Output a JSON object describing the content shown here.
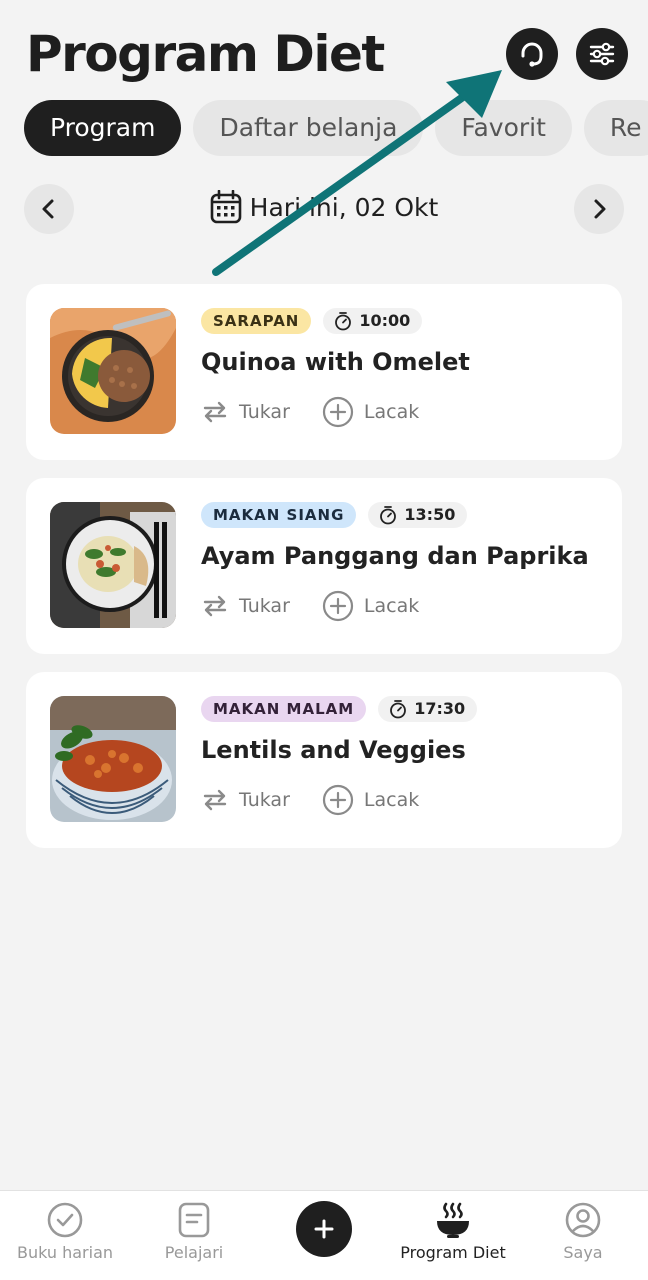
{
  "header": {
    "title": "Program Diet",
    "support_icon": "headset-icon",
    "filter_icon": "sliders-icon"
  },
  "tabs": [
    {
      "label": "Program",
      "active": true
    },
    {
      "label": "Daftar belanja",
      "active": false
    },
    {
      "label": "Favorit",
      "active": false
    },
    {
      "label": "Re",
      "active": false
    }
  ],
  "date_nav": {
    "label": "Hari ini, 02 Okt"
  },
  "meals": [
    {
      "tag": "SARAPAN",
      "time": "10:00",
      "name": "Quinoa with Omelet",
      "swap_label": "Tukar",
      "track_label": "Lacak"
    },
    {
      "tag": "MAKAN SIANG",
      "time": "13:50",
      "name": "Ayam Panggang dan Paprika",
      "swap_label": "Tukar",
      "track_label": "Lacak"
    },
    {
      "tag": "MAKAN MALAM",
      "time": "17:30",
      "name": "Lentils and Veggies",
      "swap_label": "Tukar",
      "track_label": "Lacak"
    }
  ],
  "bottom_nav": [
    {
      "label": "Buku harian",
      "icon": "check-circle-icon",
      "active": false
    },
    {
      "label": "Pelajari",
      "icon": "document-icon",
      "active": false
    },
    {
      "label": "",
      "icon": "plus-icon",
      "active": false
    },
    {
      "label": "Program Diet",
      "icon": "steaming-bowl-icon",
      "active": true
    },
    {
      "label": "Saya",
      "icon": "profile-icon",
      "active": false
    }
  ],
  "colors": {
    "accent_dark": "#1f1f1f",
    "annotation_arrow": "#0f7477",
    "breakfast": "#fbe6a3",
    "lunch": "#cfe6fb",
    "dinner": "#e9d6f0"
  }
}
